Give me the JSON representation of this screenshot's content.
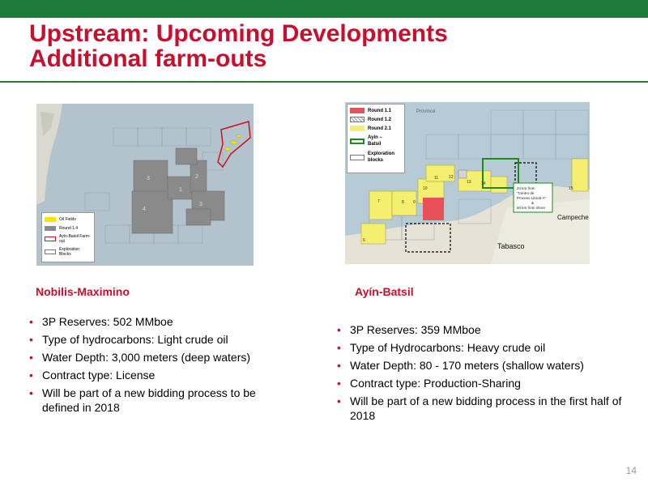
{
  "slide": {
    "title_line1": "Upstream: Upcoming Developments",
    "title_line2": "Additional farm-outs",
    "page_number": "14"
  },
  "colors": {
    "accent_red": "#c8102e",
    "brand_green": "#1f7a3a"
  },
  "left_map": {
    "block_labels": [
      "3",
      "2",
      "1",
      "4",
      "3"
    ],
    "legend": [
      {
        "label": "Oil Fields",
        "icon": "yellow-swatch"
      },
      {
        "label": "Round 1.4",
        "icon": "gray-swatch"
      },
      {
        "label": "Ayín-Batsil Farm-out",
        "icon": "red-outline-swatch"
      },
      {
        "label": "Exploration Blocks",
        "icon": "white-swatch"
      }
    ]
  },
  "right_map": {
    "province_label": "Province",
    "callout": [
      "24 km from",
      "\"Centro de",
      "Proceso Litoral-A\"",
      "&",
      "50 km from shore"
    ],
    "place_labels": {
      "campeche": "Campeche",
      "tabasco": "Tabasco"
    },
    "block_numbers": [
      "11",
      "10",
      "12",
      "13",
      "14",
      "7",
      "8",
      "9",
      "15",
      "6"
    ],
    "legend": [
      {
        "label": "Round 1.1",
        "icon": "red-swatch"
      },
      {
        "label": "Round 1.2",
        "icon": "hatched-swatch"
      },
      {
        "label": "Round 2.1",
        "icon": "yellow-swatch"
      },
      {
        "label": "Ayín – Batsil",
        "icon": "green-outline-swatch"
      },
      {
        "label": "Exploration blocks",
        "icon": "white-swatch"
      }
    ]
  },
  "left_section": {
    "heading": "Nobilis-Maximino",
    "bullets": [
      "3P Reserves: 502 MMboe",
      "Type of hydrocarbons: Light crude oil",
      "Water Depth: 3,000 meters (deep waters)",
      "Contract type: License",
      "Will be part of a new bidding process to be defined in 2018"
    ]
  },
  "right_section": {
    "heading": "Ayín-Batsil",
    "bullets": [
      "3P Reserves: 359 MMboe",
      "Type of Hydrocarbons: Heavy crude oil",
      "Water Depth: 80 - 170 meters (shallow waters)",
      "Contract type: Production-Sharing",
      "Will be part of a new bidding process in the first half of 2018"
    ]
  }
}
